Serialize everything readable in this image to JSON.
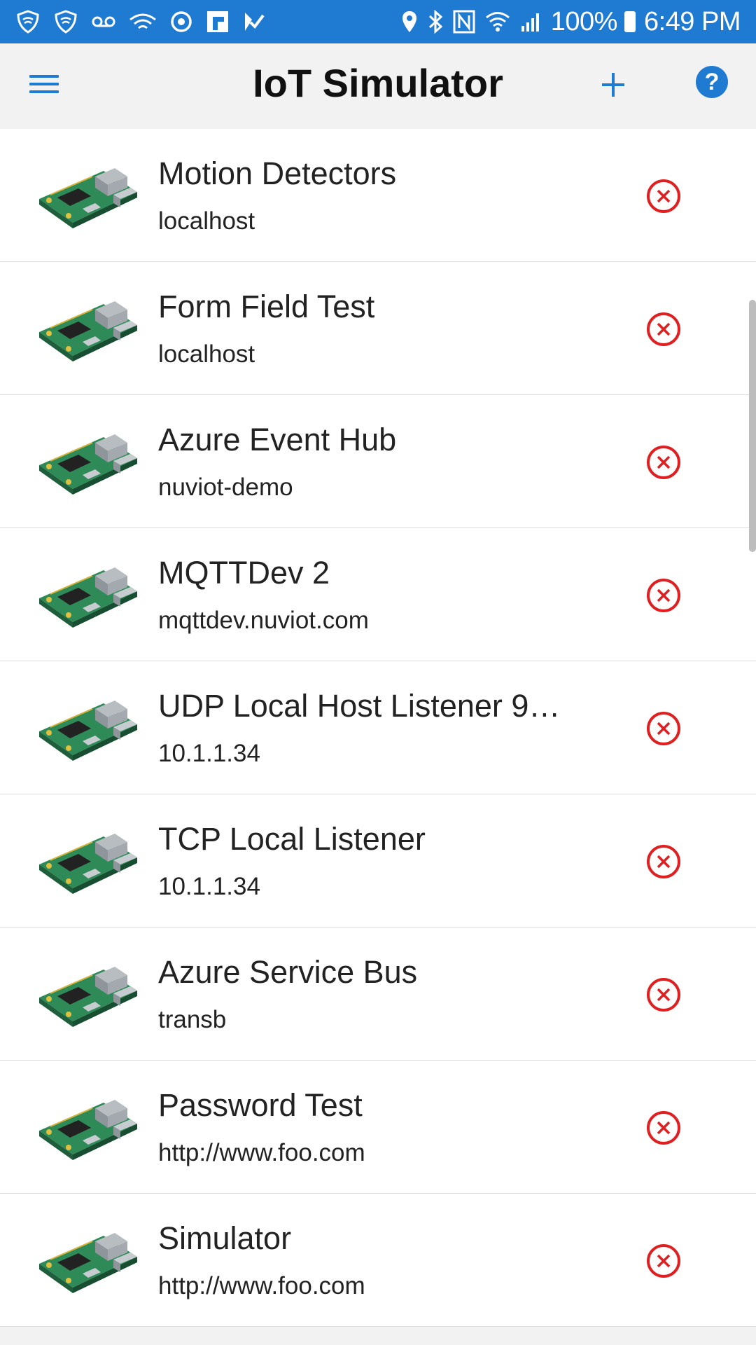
{
  "status_bar": {
    "battery": "100%",
    "time": "6:49 PM",
    "icons": [
      "shield-icon",
      "shield-icon",
      "voicemail-icon",
      "wifi-icon",
      "sync-icon",
      "flipboard-icon",
      "check-icon",
      "location-icon",
      "bluetooth-icon",
      "nfc-icon",
      "wifi-icon",
      "signal-icon",
      "battery-icon"
    ]
  },
  "header": {
    "title": "IoT Simulator",
    "menu_icon": "hamburger-icon",
    "add_icon": "plus-icon",
    "help_label": "?"
  },
  "colors": {
    "accent": "#1f7ad2",
    "delete": "#e02020",
    "background": "#f2f2f2"
  },
  "simulators": [
    {
      "name": "Motion Detectors",
      "host": "localhost"
    },
    {
      "name": "Form Field Test",
      "host": "localhost"
    },
    {
      "name": "Azure Event Hub",
      "host": "nuviot-demo"
    },
    {
      "name": "MQTTDev 2",
      "host": "mqttdev.nuviot.com"
    },
    {
      "name": "UDP Local Host Listener 9…",
      "host": "10.1.1.34"
    },
    {
      "name": "TCP Local Listener",
      "host": "10.1.1.34"
    },
    {
      "name": "Azure Service Bus",
      "host": "transb"
    },
    {
      "name": "Password Test",
      "host": "http://www.foo.com"
    },
    {
      "name": "Simulator",
      "host": "http://www.foo.com"
    }
  ]
}
